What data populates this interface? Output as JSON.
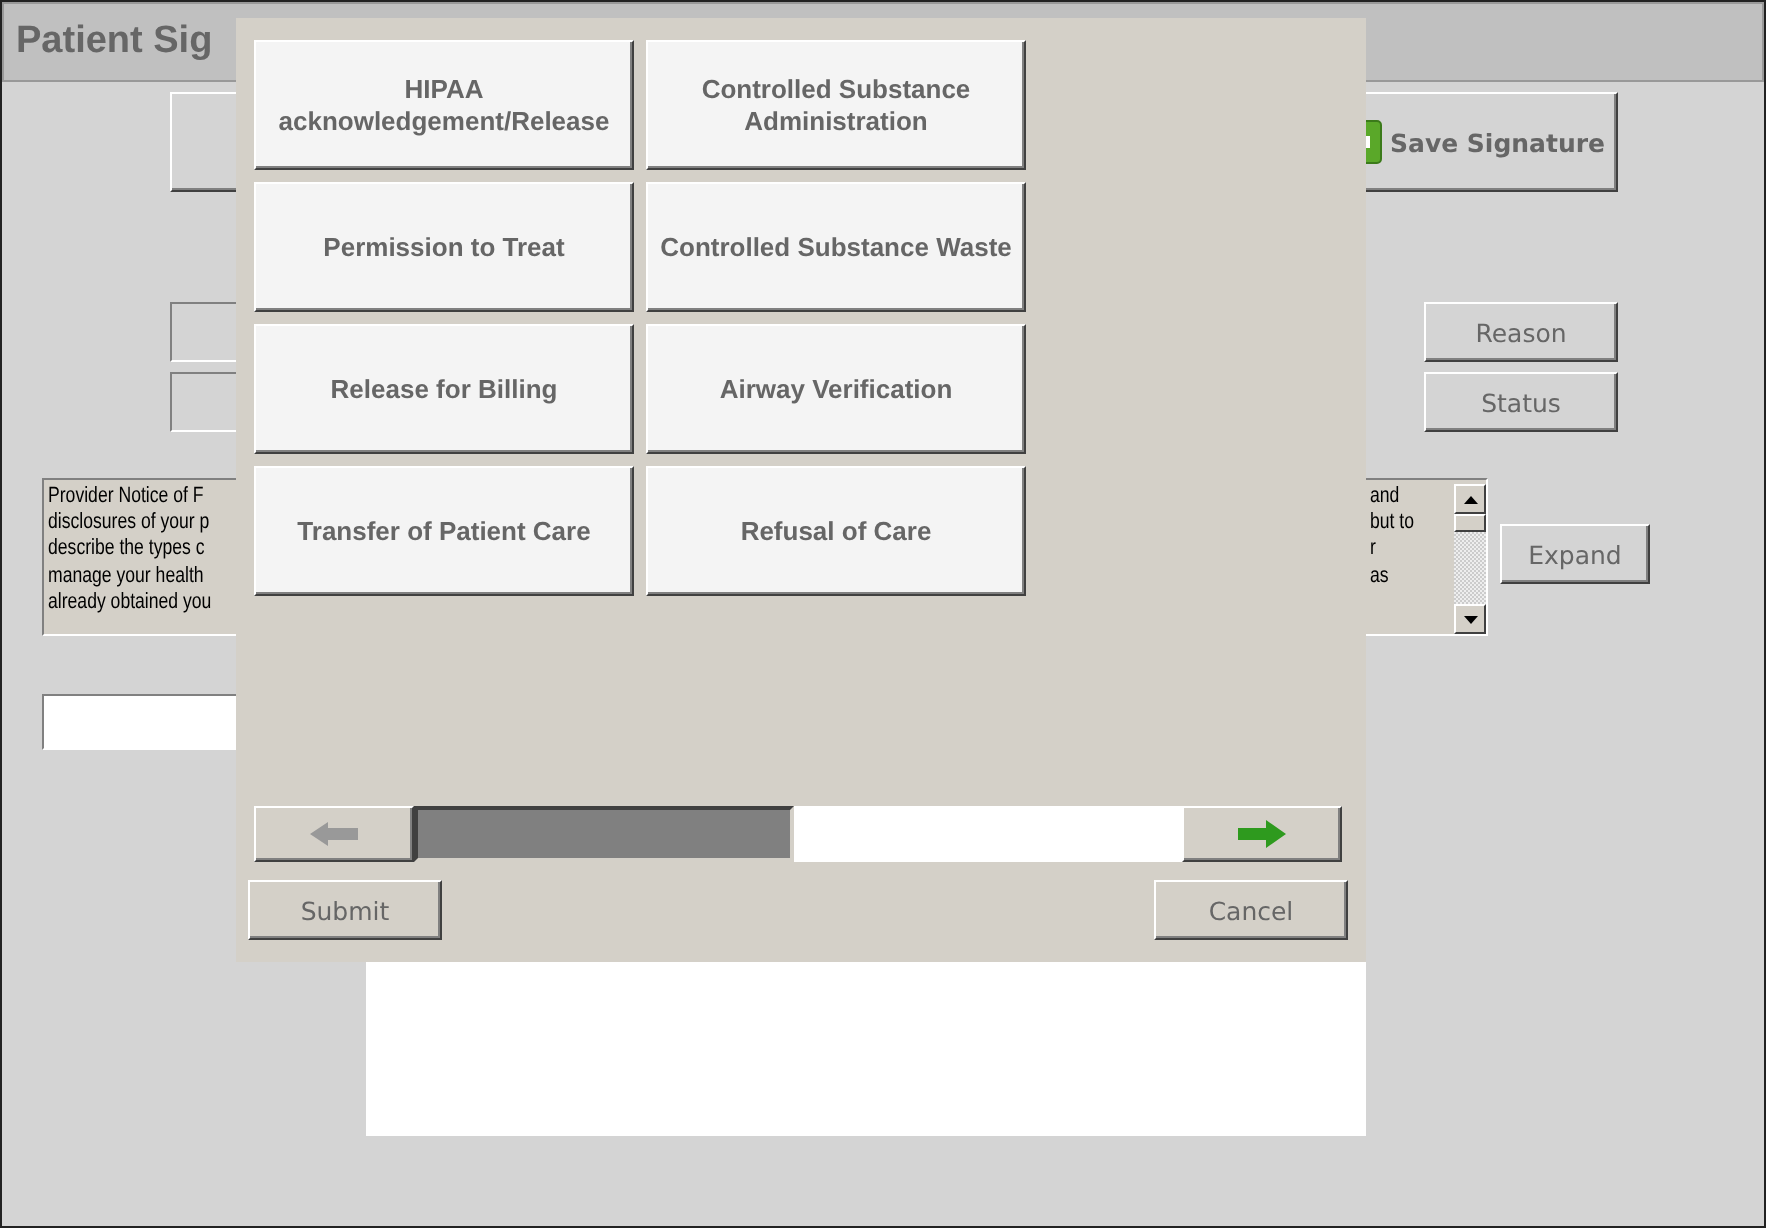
{
  "window": {
    "title": "Patient Sig"
  },
  "save_button": "Save Signature",
  "side_buttons": [
    "Reason",
    "Status"
  ],
  "notice": {
    "lines": [
      {
        "start": "Provider Notice of F",
        "end": "and"
      },
      {
        "start": "disclosures of your p",
        "end": "but to"
      },
      {
        "start": "describe the types c",
        "end": "r"
      },
      {
        "start": "manage your health",
        "end": "as"
      },
      {
        "start": "already obtained you"
      }
    ]
  },
  "expand_button": "Expand",
  "dialog": {
    "options": [
      "HIPAA acknowledgement/Release",
      "Controlled Substance Administration",
      "Permission to Treat",
      "Controlled Substance Waste",
      "Release for Billing",
      "Airway Verification",
      "Transfer of Patient Care",
      "Refusal of Care"
    ],
    "buttons": [
      "Submit",
      "Cancel"
    ]
  }
}
